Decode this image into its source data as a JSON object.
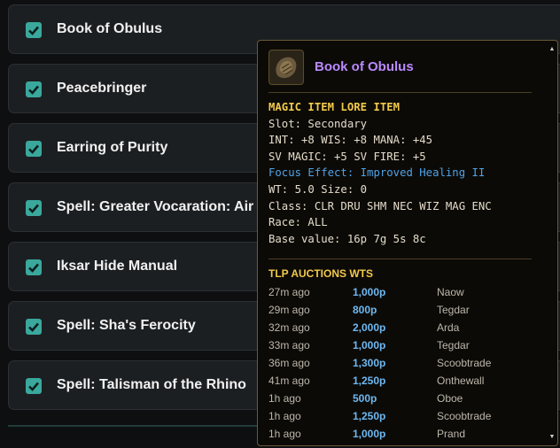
{
  "list": {
    "items": [
      {
        "label": "Book of Obulus"
      },
      {
        "label": "Peacebringer"
      },
      {
        "label": "Earring of Purity"
      },
      {
        "label": "Spell: Greater Vocaration: Air"
      },
      {
        "label": "Iksar Hide Manual"
      },
      {
        "label": "Spell: Sha's Ferocity"
      },
      {
        "label": "Spell: Talisman of the Rhino"
      }
    ]
  },
  "tooltip": {
    "title": "Book of Obulus",
    "icon": "book-icon",
    "lore_lines": {
      "header": "MAGIC ITEM LORE ITEM",
      "slot": "Slot: Secondary",
      "stats1": "INT: +8 WIS: +8 MANA: +45",
      "stats2": "SV MAGIC: +5 SV FIRE: +5",
      "focus": "Focus Effect: Improved Healing II",
      "weight": "WT: 5.0 Size: 0",
      "class": "Class: CLR DRU SHM NEC WIZ MAG ENC",
      "race": "Race: ALL",
      "value": "Base value: 16p 7g 5s 8c"
    },
    "auctions_title": "TLP AUCTIONS WTS",
    "auctions": [
      {
        "time": "27m ago",
        "price": "1,000p",
        "seller": "Naow"
      },
      {
        "time": "29m ago",
        "price": "800p",
        "seller": "Tegdar"
      },
      {
        "time": "32m ago",
        "price": "2,000p",
        "seller": "Arda"
      },
      {
        "time": "33m ago",
        "price": "1,000p",
        "seller": "Tegdar"
      },
      {
        "time": "36m ago",
        "price": "1,300p",
        "seller": "Scoobtrade"
      },
      {
        "time": "41m ago",
        "price": "1,250p",
        "seller": "Onthewall"
      },
      {
        "time": "1h ago",
        "price": "500p",
        "seller": "Oboe"
      },
      {
        "time": "1h ago",
        "price": "1,250p",
        "seller": "Scoobtrade"
      },
      {
        "time": "1h ago",
        "price": "1,000p",
        "seller": "Prand"
      }
    ]
  },
  "colors": {
    "checkbox": "#3aa89c",
    "item_title": "#b98aff",
    "lore_header": "#f2c94c",
    "focus": "#4fa3e8",
    "price": "#6db8f2"
  }
}
